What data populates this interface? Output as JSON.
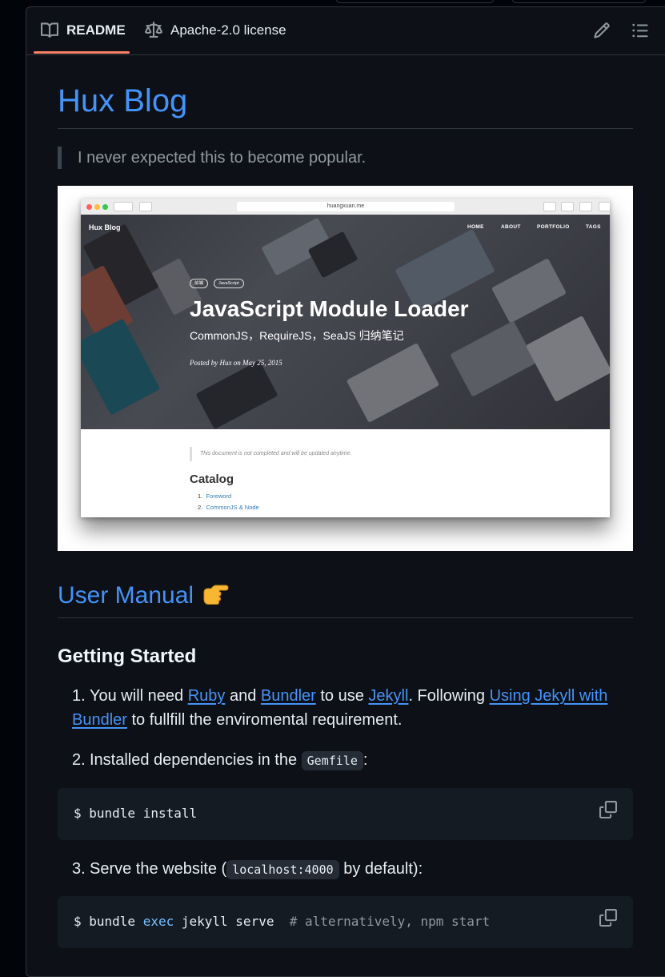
{
  "tabs": {
    "readme_label": "README",
    "license_label": "Apache-2.0 license"
  },
  "readme": {
    "title": "Hux Blog",
    "quote": "I never expected this to become popular.",
    "screenshot": {
      "url": "huangxuan.me",
      "brand": "Hux Blog",
      "nav": [
        "HOME",
        "ABOUT",
        "PORTFOLIO",
        "TAGS"
      ],
      "tags": [
        "前端",
        "JavaScript"
      ],
      "title": "JavaScript Module Loader",
      "subtitle": "CommonJS，RequireJS，SeaJS 归纳笔记",
      "meta": "Posted by Hux on May 25, 2015",
      "notice": "This document is not completed and will be updated anytime.",
      "catalog_heading": "Catalog",
      "catalog_items": [
        "Foreword",
        "CommonJS & Node"
      ]
    },
    "user_manual_heading": "User Manual",
    "user_manual_emoji": "👉",
    "getting_started_heading": "Getting Started",
    "steps": {
      "step1": {
        "num": "1.",
        "t1": "You will need ",
        "ruby": "Ruby",
        "t2": " and ",
        "bundler": "Bundler",
        "t3": " to use ",
        "jekyll": "Jekyll",
        "t4": ". Following ",
        "using_link": "Using Jekyll with Bundler",
        "t5": " to fullfill the enviromental requirement."
      },
      "step2": {
        "num": "2.",
        "text": "Installed dependencies in the ",
        "code": "Gemfile",
        "end": ":"
      },
      "step3": {
        "num": "3.",
        "text": "Serve the website (",
        "code": "localhost:4000",
        "end": " by default):"
      }
    },
    "code1": "$ bundle install",
    "code2": {
      "prefix": "$ bundle ",
      "kw": "exec",
      "rest": " jekyll serve  ",
      "comment": "# alternatively, npm start"
    }
  },
  "colors": {
    "link": "#4493f8",
    "tab_underline": "#f78166",
    "background": "#0d1117",
    "code_bg": "#151b23"
  }
}
